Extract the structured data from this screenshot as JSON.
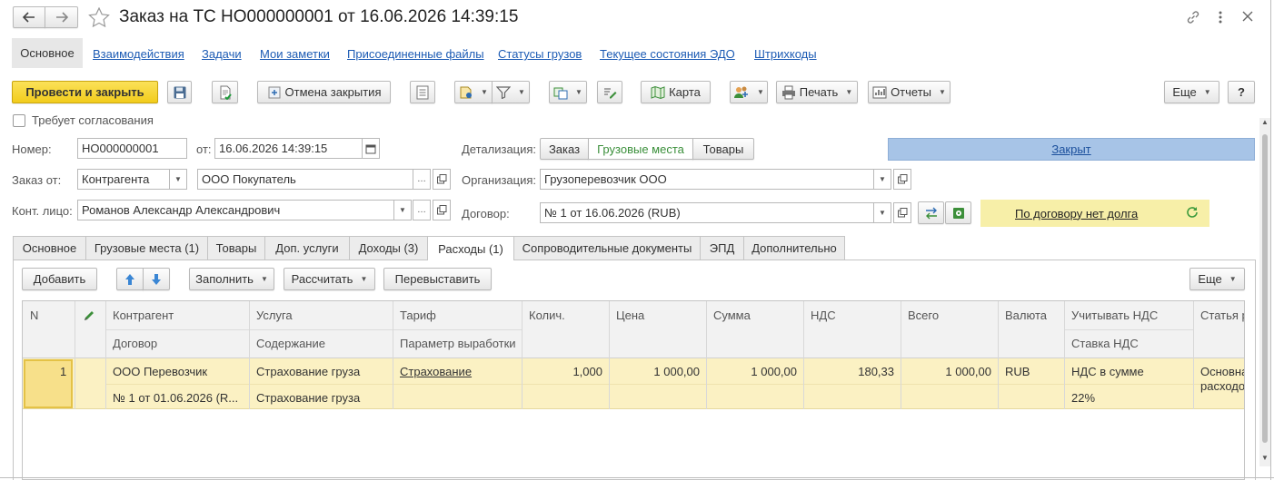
{
  "window": {
    "title": "Заказ на ТС НО000000001 от 16.06.2026 14:39:15"
  },
  "nav": {
    "items": [
      "Основное",
      "Взаимодействия",
      "Задачи",
      "Мои заметки",
      "Присоединенные файлы",
      "Статусы грузов",
      "Текущее состояния ЭДО",
      "Штрихкоды"
    ]
  },
  "toolbar": {
    "post_close": "Провести и закрыть",
    "cancel_close": "Отмена закрытия",
    "map": "Карта",
    "print": "Печать",
    "reports": "Отчеты",
    "more": "Еще",
    "help": "?"
  },
  "form": {
    "requires_approval": "Требует согласования",
    "number_label": "Номер:",
    "number_value": "НО000000001",
    "from_label": "от:",
    "date_value": "16.06.2026 14:39:15",
    "detail_label": "Детализация:",
    "detail_options": [
      "Заказ",
      "Грузовые места",
      "Товары"
    ],
    "status": "Закрыт",
    "order_from_label": "Заказ от:",
    "order_from_type": "Контрагента",
    "order_from_value": "ООО Покупатель",
    "org_label": "Организация:",
    "org_value": "Грузоперевозчик ООО",
    "contact_label": "Конт. лицо:",
    "contact_value": "Романов Александр Александрович",
    "contract_label": "Договор:",
    "contract_value": "№ 1 от 16.06.2026 (RUB)",
    "debt_note": "По договору нет долга"
  },
  "tabs": [
    "Основное",
    "Грузовые места (1)",
    "Товары",
    "Доп. услуги",
    "Доходы (3)",
    "Расходы (1)",
    "Сопроводительные документы",
    "ЭПД",
    "Дополнительно"
  ],
  "subtoolbar": {
    "add": "Добавить",
    "fill": "Заполнить",
    "calculate": "Рассчитать",
    "reissue": "Перевыставить",
    "more": "Еще"
  },
  "table": {
    "headers_top": [
      "N",
      "Контрагент",
      "Услуга",
      "Тариф",
      "Колич.",
      "Цена",
      "Сумма",
      "НДС",
      "Всего",
      "Валюта",
      "Учитывать НДС",
      "Статья р"
    ],
    "headers_bottom": [
      "Договор",
      "Содержание",
      "Параметр выработки",
      "Ставка НДС"
    ],
    "row": {
      "n": "1",
      "counterparty": "ООО Перевозчик",
      "contract": "№ 1 от 01.06.2026 (R...",
      "service": "Страхование груза",
      "content": "Страхование груза",
      "tariff": "Страхование",
      "qty": "1,000",
      "price": "1 000,00",
      "sum": "1 000,00",
      "vat": "180,33",
      "total": "1 000,00",
      "currency": "RUB",
      "vat_mode": "НДС в сумме",
      "vat_rate": "22%",
      "article_1": "Основна",
      "article_2": "расходо"
    }
  },
  "colors": {
    "accent_yellow": "#f5d431",
    "status_blue": "#a7c4e7",
    "debt_yellow": "#f7efa8",
    "row_highlight": "#fbf1c3"
  }
}
